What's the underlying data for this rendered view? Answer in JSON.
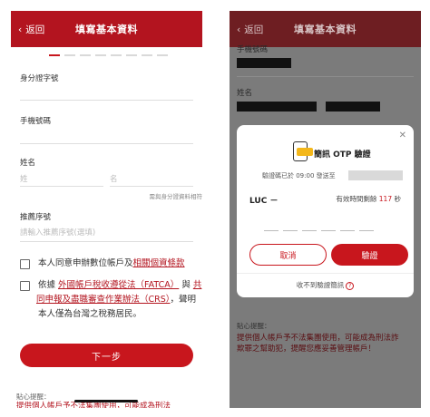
{
  "left": {
    "nav": {
      "back": "返回",
      "title": "填寫基本資料"
    },
    "fields": {
      "id_label": "身分證字號",
      "phone_label": "手機號碼",
      "name_label": "姓名",
      "surname_placeholder": "姓",
      "given_placeholder": "名",
      "name_note": "需與身分證資料相符",
      "referral_label": "推薦序號",
      "referral_placeholder": "請輸入推薦序號(選填)"
    },
    "agree1": {
      "text": "本人同意申辦數位帳戶及",
      "link": "相關個資條款"
    },
    "agree2": {
      "prefix": "依據",
      "link1": "外國帳戶稅收遵從法（FATCA）",
      "mid": "與",
      "link2a": "共",
      "link2b": "同申報及盡職審查作業辦法（CRS）",
      "suffix_a": "，聲明",
      "suffix_b": "本人僅為台灣之稅務居民。"
    },
    "next_button": "下一步",
    "tip_label": "貼心提醒：",
    "tip_text": "提供個人帳戶予不法集團使用，可能成為刑法"
  },
  "right": {
    "nav": {
      "back": "返回",
      "title": "填寫基本資料"
    },
    "phone_label": "手機號碼",
    "name_label": "姓名",
    "modal": {
      "close": "✕",
      "title": "簡訊 OTP 驗證",
      "sent_text": "驗證碼已於 09:00 發送至",
      "prefix_code": "LUC －",
      "expire_text": "有效時間剩餘",
      "expire_seconds": "117",
      "expire_unit": "秒",
      "cancel_button": "取消",
      "verify_button": "驗證",
      "no_otp": "收不到驗證簡訊"
    },
    "tip_label": "貼心提醒：",
    "tip_line1": "提供個人帳戶予不法集團使用，可能成為刑法詐",
    "tip_line2": "欺罪之幫助犯，提醒您應妥善管理帳戶！"
  }
}
